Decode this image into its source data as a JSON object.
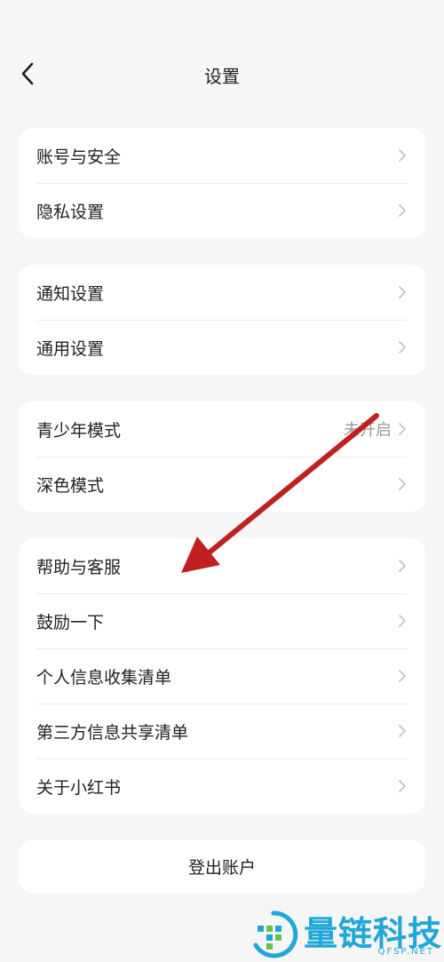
{
  "header": {
    "title": "设置",
    "back_icon": "chevron-left-icon"
  },
  "groups": [
    {
      "items": [
        {
          "label": "账号与安全"
        },
        {
          "label": "隐私设置"
        }
      ]
    },
    {
      "items": [
        {
          "label": "通知设置"
        },
        {
          "label": "通用设置"
        }
      ]
    },
    {
      "items": [
        {
          "label": "青少年模式",
          "value": "未开启"
        },
        {
          "label": "深色模式"
        }
      ]
    },
    {
      "items": [
        {
          "label": "帮助与客服"
        },
        {
          "label": "鼓励一下"
        },
        {
          "label": "个人信息收集清单"
        },
        {
          "label": "第三方信息共享清单"
        },
        {
          "label": "关于小红书"
        }
      ]
    }
  ],
  "logout": {
    "label": "登出账户"
  },
  "watermark": {
    "title": "量链科技",
    "subtitle": "QFSP.NET"
  },
  "colors": {
    "background": "#f6f6f6",
    "card": "#ffffff",
    "arrow": "#c0201f",
    "watermark": "#1fa7d8"
  }
}
